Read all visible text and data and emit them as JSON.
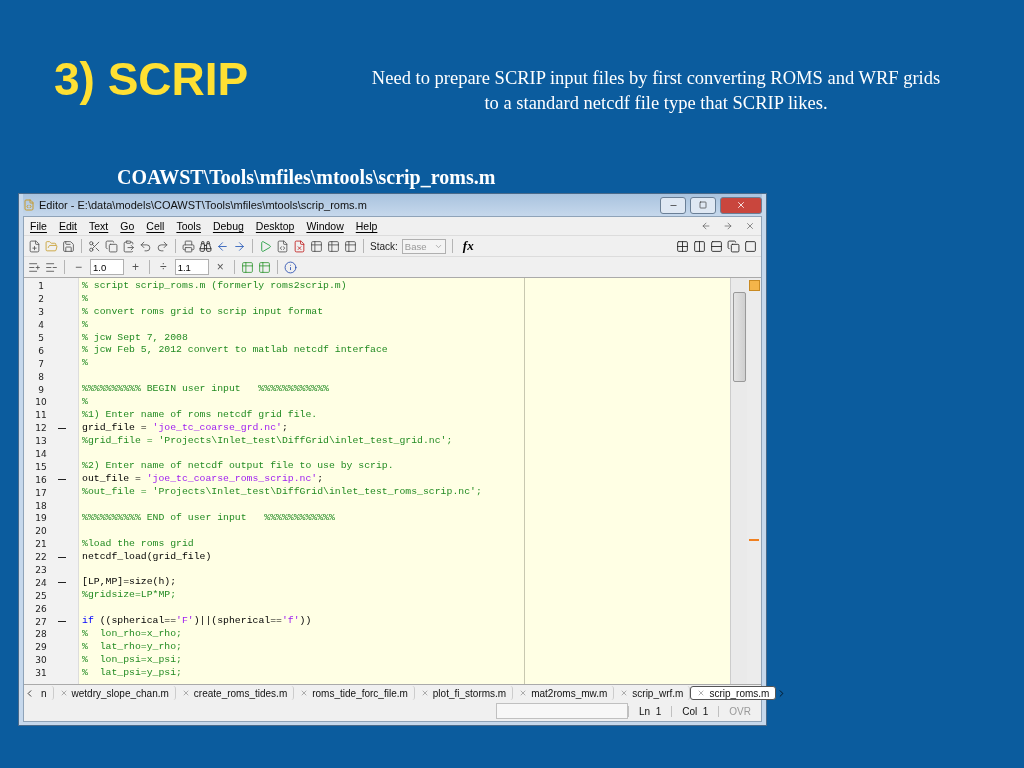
{
  "slide": {
    "title": "3) SCRIP",
    "description": "Need to prepare SCRIP input files by first converting ROMS and WRF grids to a standard netcdf file type that SCRIP likes.",
    "path": "COAWST\\Tools\\mfiles\\mtools\\scrip_roms.m"
  },
  "window": {
    "title": "Editor - E:\\data\\models\\COAWST\\Tools\\mfiles\\mtools\\scrip_roms.m"
  },
  "menu": [
    "File",
    "Edit",
    "Text",
    "Go",
    "Cell",
    "Tools",
    "Debug",
    "Desktop",
    "Window",
    "Help"
  ],
  "toolbar": {
    "stack_label": "Stack:",
    "stack_value": "Base",
    "fx": "fx"
  },
  "cell_toolbar": {
    "minus": "−",
    "first_value": "1.0",
    "plus": "+",
    "divide": "÷",
    "second_value": "1.1",
    "times": "×"
  },
  "editor": {
    "lines": [
      {
        "number": "1",
        "executable": false,
        "segments": [
          {
            "kind": "comment",
            "text": "% script scrip_roms.m (formerly roms2scrip.m)"
          }
        ]
      },
      {
        "number": "2",
        "executable": false,
        "segments": [
          {
            "kind": "comment",
            "text": "%"
          }
        ]
      },
      {
        "number": "3",
        "executable": false,
        "segments": [
          {
            "kind": "comment",
            "text": "% convert roms grid to scrip input format"
          }
        ]
      },
      {
        "number": "4",
        "executable": false,
        "segments": [
          {
            "kind": "comment",
            "text": "%"
          }
        ]
      },
      {
        "number": "5",
        "executable": false,
        "segments": [
          {
            "kind": "comment",
            "text": "% jcw Sept 7, 2008"
          }
        ]
      },
      {
        "number": "6",
        "executable": false,
        "segments": [
          {
            "kind": "comment",
            "text": "% jcw Feb 5, 2012 convert to matlab netcdf interface"
          }
        ]
      },
      {
        "number": "7",
        "executable": false,
        "segments": [
          {
            "kind": "comment",
            "text": "%"
          }
        ]
      },
      {
        "number": "8",
        "executable": false
      },
      {
        "number": "9",
        "executable": false,
        "segments": [
          {
            "kind": "comment",
            "text": "%%%%%%%%%% BEGIN user input   %%%%%%%%%%%%"
          }
        ]
      },
      {
        "number": "10",
        "executable": false,
        "segments": [
          {
            "kind": "comment",
            "text": "%"
          }
        ]
      },
      {
        "number": "11",
        "executable": false,
        "segments": [
          {
            "kind": "comment",
            "text": "%1) Enter name of roms netcdf grid file."
          }
        ]
      },
      {
        "number": "12",
        "executable": true,
        "segments": [
          {
            "kind": "code",
            "text": "grid_file = "
          },
          {
            "kind": "string",
            "text": "'joe_tc_coarse_grd.nc'"
          },
          {
            "kind": "code",
            "text": ";"
          }
        ]
      },
      {
        "number": "13",
        "executable": false,
        "segments": [
          {
            "kind": "comment",
            "text": "%grid_file = 'Projects\\Inlet_test\\DiffGrid\\inlet_test_grid.nc';"
          }
        ]
      },
      {
        "number": "14",
        "executable": false
      },
      {
        "number": "15",
        "executable": false,
        "segments": [
          {
            "kind": "comment",
            "text": "%2) Enter name of netcdf output file to use by scrip."
          }
        ]
      },
      {
        "number": "16",
        "executable": true,
        "segments": [
          {
            "kind": "code",
            "text": "out_file = "
          },
          {
            "kind": "string",
            "text": "'joe_tc_coarse_roms_scrip.nc'"
          },
          {
            "kind": "code",
            "text": ";"
          }
        ]
      },
      {
        "number": "17",
        "executable": false,
        "segments": [
          {
            "kind": "comment",
            "text": "%out_file = 'Projects\\Inlet_test\\DiffGrid\\inlet_test_roms_scrip.nc';"
          }
        ]
      },
      {
        "number": "18",
        "executable": false
      },
      {
        "number": "19",
        "executable": false,
        "segments": [
          {
            "kind": "comment",
            "text": "%%%%%%%%%% END of user input   %%%%%%%%%%%%"
          }
        ]
      },
      {
        "number": "20",
        "executable": false
      },
      {
        "number": "21",
        "executable": false,
        "segments": [
          {
            "kind": "comment",
            "text": "%load the roms grid"
          }
        ]
      },
      {
        "number": "22",
        "executable": true,
        "segments": [
          {
            "kind": "code",
            "text": "netcdf_load(grid_file)"
          }
        ]
      },
      {
        "number": "23",
        "executable": false
      },
      {
        "number": "24",
        "executable": true,
        "segments": [
          {
            "kind": "code",
            "text": "[LP,MP]=size(h);"
          }
        ]
      },
      {
        "number": "25",
        "executable": false,
        "segments": [
          {
            "kind": "comment",
            "text": "%gridsize=LP*MP;"
          }
        ]
      },
      {
        "number": "26",
        "executable": false
      },
      {
        "number": "27",
        "executable": true,
        "segments": [
          {
            "kind": "keyword",
            "text": "if"
          },
          {
            "kind": "code",
            "text": " ((spherical=="
          },
          {
            "kind": "string",
            "text": "'F'"
          },
          {
            "kind": "code",
            "text": ")||(spherical=="
          },
          {
            "kind": "string",
            "text": "'f'"
          },
          {
            "kind": "code",
            "text": "))"
          }
        ]
      },
      {
        "number": "28",
        "executable": false,
        "segments": [
          {
            "kind": "comment",
            "text": "%  lon_rho=x_rho;"
          }
        ]
      },
      {
        "number": "29",
        "executable": false,
        "segments": [
          {
            "kind": "comment",
            "text": "%  lat_rho=y_rho;"
          }
        ]
      },
      {
        "number": "30",
        "executable": false,
        "segments": [
          {
            "kind": "comment",
            "text": "%  lon_psi=x_psi;"
          }
        ]
      },
      {
        "number": "31",
        "executable": false,
        "segments": [
          {
            "kind": "comment",
            "text": "%  lat_psi=y_psi;"
          }
        ]
      }
    ]
  },
  "tabs": [
    {
      "label": "n",
      "selected": false
    },
    {
      "label": "wetdry_slope_chan.m",
      "selected": false
    },
    {
      "label": "create_roms_tides.m",
      "selected": false
    },
    {
      "label": "roms_tide_forc_file.m",
      "selected": false
    },
    {
      "label": "plot_fi_storms.m",
      "selected": false
    },
    {
      "label": "mat2roms_mw.m",
      "selected": false
    },
    {
      "label": "scrip_wrf.m",
      "selected": false
    },
    {
      "label": "scrip_roms.m",
      "selected": true
    }
  ],
  "status_bar": {
    "line": "Ln  1",
    "column": "Col  1",
    "mode": "OVR"
  }
}
